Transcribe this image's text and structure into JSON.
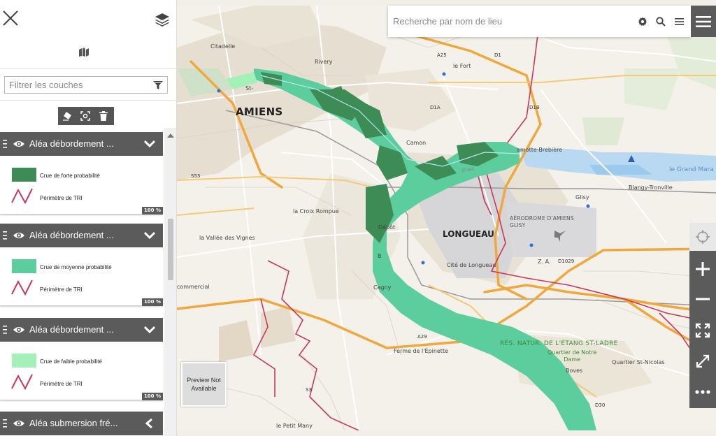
{
  "search": {
    "placeholder": "Recherche par nom de lieu",
    "settings_icon": "gear-icon",
    "search_icon": "magnifier-icon",
    "list_icon": "list-icon"
  },
  "panel": {
    "filter_placeholder": "Filtrer les couches",
    "layers": [
      {
        "name": "Aléa débordement ...",
        "legend": [
          {
            "label": "Crue de forte probabilité",
            "color": "#3d8c55"
          },
          {
            "label": "Périmètre de TRI",
            "color": "#c8385e"
          }
        ],
        "opacity": "100 %",
        "expanded": true
      },
      {
        "name": "Aléa débordement ...",
        "legend": [
          {
            "label": "Crue de moyenne probabilité",
            "color": "#5ccd9d"
          },
          {
            "label": "Périmètre de TRI",
            "color": "#c8385e"
          }
        ],
        "opacity": "100 %",
        "expanded": true
      },
      {
        "name": "Aléa débordement ...",
        "legend": [
          {
            "label": "Crue de faible probabilité",
            "color": "#a3f0b8"
          },
          {
            "label": "Périmètre de TRI",
            "color": "#c8385e"
          }
        ],
        "opacity": "100 %",
        "expanded": true
      },
      {
        "name": "Aléa submersion fré...",
        "expanded": false
      }
    ]
  },
  "map": {
    "labels": {
      "amiens": "AMIENS",
      "longueau": "LONGUEAU",
      "citadelle": "Citadelle",
      "rivery": "Rivery",
      "le_fort": "le Fort",
      "camon": "Camon",
      "lamotte": "amotte-Brebière",
      "blangy": "Blangy-Tronville",
      "glisy": "Glisy",
      "grand_marais": "le Grand Mara",
      "aerodrome": "AÉRODROME D'AMIENS\nGLISY",
      "croix_rompue": "la Croix Rompue",
      "vallee_vignes": "la Vallée des Vignes",
      "depot": "Dépôt",
      "cite_longueau": "Cité de Longueau",
      "za": "Z. A.",
      "commercial": "commercial",
      "cagny": "Cagny",
      "ferme_epinette": "Ferme de l'Épinette",
      "reserve": "RÉS. NATUR. DE L'ÉTANG ST-LADRE",
      "quartier_notre_dame": "Quartier de Notre\nDame",
      "boves": "Boves",
      "quartier_st_nicolas": "Quartier St-Nicolas",
      "petit_many": "le Petit Many",
      "st_a": "St-",
      "b": "B",
      "guet": "guet"
    },
    "roads": [
      "A25",
      "D1",
      "D1A",
      "D1B",
      "A29",
      "D1029",
      "D30",
      "S3",
      "S53"
    ]
  },
  "preview": {
    "text": "Preview Not Available"
  },
  "colors": {
    "flood_strong": "#3d8c55",
    "flood_medium": "#5ccd9d",
    "flood_low": "#a3f0b8",
    "tri": "#c8385e",
    "road_orange": "#f0a83c",
    "toolbar": "#5b5b5b"
  }
}
